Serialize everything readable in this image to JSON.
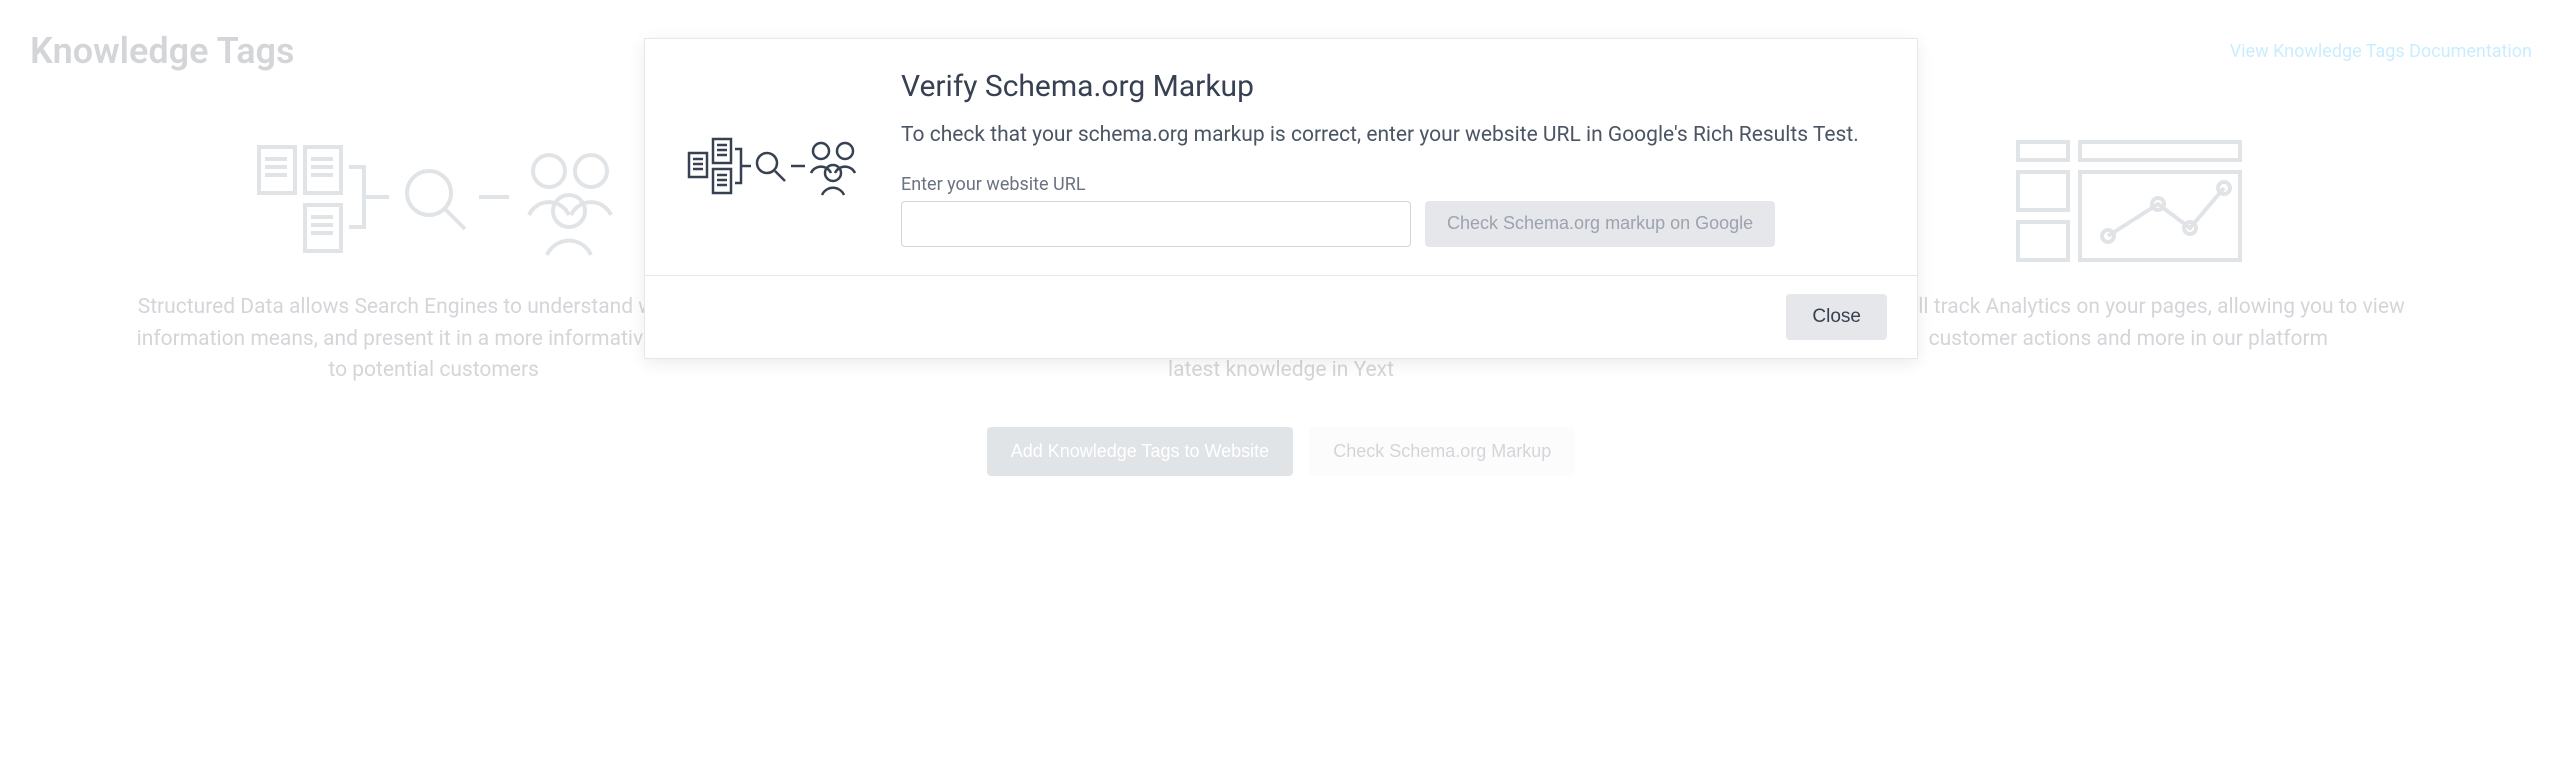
{
  "header": {
    "title": "Knowledge Tags",
    "doc_link": "View Knowledge Tags Documentation"
  },
  "columns": [
    {
      "text": "Structured Data allows Search Engines to understand what your information means, and present it in a more informative manner to potential customers"
    },
    {
      "text": "Yext keeps your Structured Data compliant and up to date with the latest standards from schema.org, as well as with your latest knowledge in Yext"
    },
    {
      "text": "Yext will track Analytics on your pages, allowing you to view customer actions and more in our platform"
    }
  ],
  "actions": {
    "primary": "Add Knowledge Tags to Website",
    "secondary": "Check Schema.org Markup"
  },
  "modal": {
    "title": "Verify Schema.org Markup",
    "desc": "To check that your schema.org markup is correct, enter your website URL in Google's Rich Results Test.",
    "field_label": "Enter your website URL",
    "input_value": "",
    "check_button": "Check Schema.org markup on Google",
    "close_button": "Close"
  }
}
